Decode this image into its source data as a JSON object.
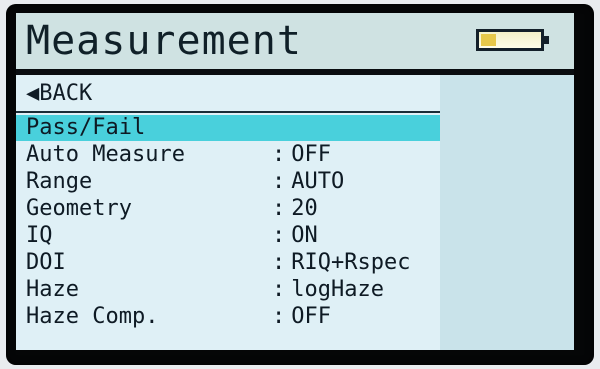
{
  "header": {
    "title": "Measurement",
    "battery_icon": "battery-icon",
    "battery_level": 0.25
  },
  "menu": {
    "back_label": "◀BACK",
    "items": [
      {
        "label": "Pass/Fail",
        "value": ""
      },
      {
        "label": "Auto Measure",
        "value": "OFF"
      },
      {
        "label": "Range",
        "value": "AUTO"
      },
      {
        "label": "Geometry",
        "value": "20"
      },
      {
        "label": "IQ",
        "value": "ON"
      },
      {
        "label": "DOI",
        "value": "RIQ+Rspec"
      },
      {
        "label": "Haze",
        "value": "logHaze"
      },
      {
        "label": "Haze Comp.",
        "value": "OFF"
      }
    ]
  },
  "colors": {
    "header_bg": "#cfe2e2",
    "panel_bg": "#dff0f6",
    "selection": "#49d0dc",
    "text": "#0e1a24"
  }
}
